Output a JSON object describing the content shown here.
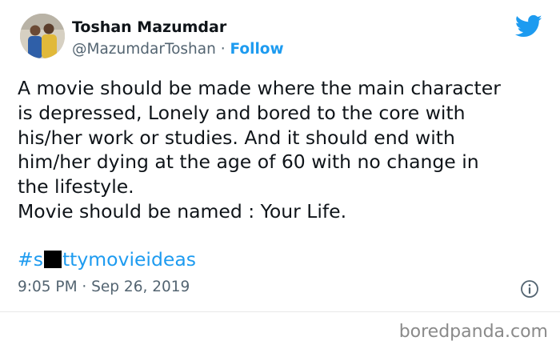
{
  "author": {
    "display_name": "Toshan Mazumdar",
    "handle": "@MazumdarToshan",
    "separator": "·",
    "follow_label": "Follow"
  },
  "tweet": {
    "lines": [
      "A movie should be made where the main character",
      "is depressed, Lonely and bored to the core with",
      "his/her work or studies. And it should end with",
      "him/her dying at the age of 60 with no change in",
      "the lifestyle.",
      "Movie should be named : Your Life."
    ],
    "hashtag_prefix": "#s",
    "hashtag_suffix": "ttymovieideas",
    "timestamp": "9:05 PM · Sep 26, 2019"
  },
  "icons": {
    "brand": "twitter-bird-icon",
    "info": "info-icon",
    "brand_color": "#1d9bf0"
  },
  "watermark": "boredpanda.com"
}
